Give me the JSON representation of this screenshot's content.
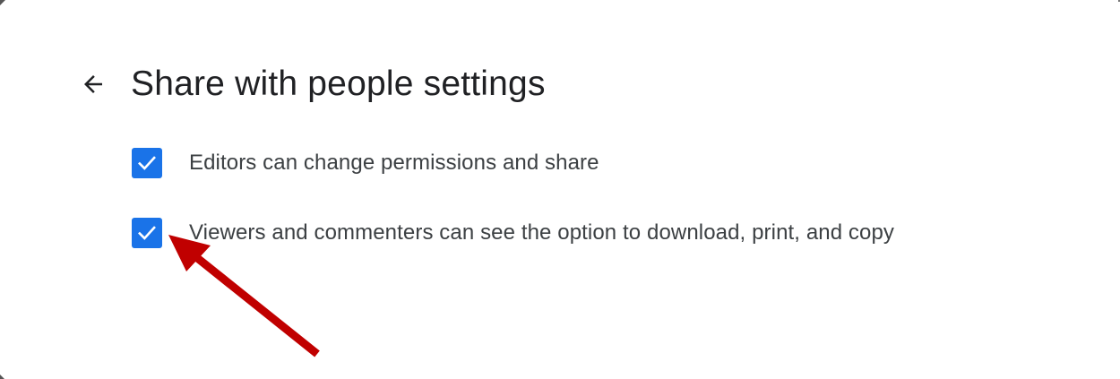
{
  "header": {
    "back_icon": "arrow-back-icon",
    "title": "Share with people settings"
  },
  "options": [
    {
      "label": "Editors can change permissions and share",
      "checked": true
    },
    {
      "label": "Viewers and commenters can see the option to download, print, and copy",
      "checked": true
    }
  ],
  "colors": {
    "checkbox": "#1a73e8",
    "checkmark": "#ffffff",
    "annotation_arrow": "#c00000",
    "title_text": "#202124",
    "label_text": "#3c4043"
  }
}
